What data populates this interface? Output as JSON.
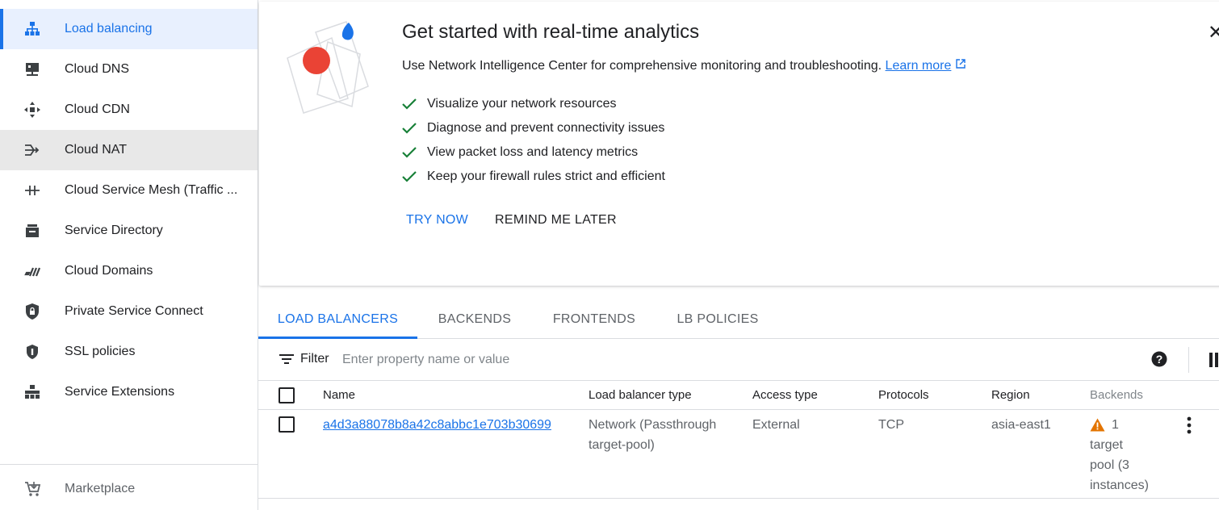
{
  "sidebar": {
    "items": [
      {
        "label": "Load balancing",
        "icon": "load-balancing-icon"
      },
      {
        "label": "Cloud DNS",
        "icon": "cloud-dns-icon"
      },
      {
        "label": "Cloud CDN",
        "icon": "cloud-cdn-icon"
      },
      {
        "label": "Cloud NAT",
        "icon": "cloud-nat-icon"
      },
      {
        "label": "Cloud Service Mesh (Traffic ...",
        "icon": "service-mesh-icon"
      },
      {
        "label": "Service Directory",
        "icon": "service-directory-icon"
      },
      {
        "label": "Cloud Domains",
        "icon": "cloud-domains-icon"
      },
      {
        "label": "Private Service Connect",
        "icon": "private-service-connect-icon"
      },
      {
        "label": "SSL policies",
        "icon": "ssl-policies-icon"
      },
      {
        "label": "Service Extensions",
        "icon": "service-extensions-icon"
      }
    ],
    "marketplace": "Marketplace"
  },
  "banner": {
    "title": "Get started with real-time analytics",
    "description": "Use Network Intelligence Center for comprehensive monitoring and troubleshooting.",
    "learn_more": "Learn more",
    "checks": [
      "Visualize your network resources",
      "Diagnose and prevent connectivity issues",
      "View packet loss and latency metrics",
      "Keep your firewall rules strict and efficient"
    ],
    "try_now": "TRY NOW",
    "remind_later": "REMIND ME LATER"
  },
  "tabs": [
    "LOAD BALANCERS",
    "BACKENDS",
    "FRONTENDS",
    "LB POLICIES"
  ],
  "filter": {
    "label": "Filter",
    "placeholder": "Enter property name or value"
  },
  "table": {
    "headers": [
      "Name",
      "Load balancer type",
      "Access type",
      "Protocols",
      "Region",
      "Backends"
    ],
    "rows": [
      {
        "name": "a4d3a88078b8a42c8abbc1e703b30699",
        "type_line1": "Network (Passthrough",
        "type_line2": "target-pool)",
        "access": "External",
        "protocols": "TCP",
        "region": "asia-east1",
        "backends_line1": "1",
        "backends_line2": "target",
        "backends_line3": "pool (3",
        "backends_line4": "instances)"
      }
    ]
  },
  "colors": {
    "accent": "#1a73e8",
    "check": "#188038",
    "warning": "#e37400"
  }
}
